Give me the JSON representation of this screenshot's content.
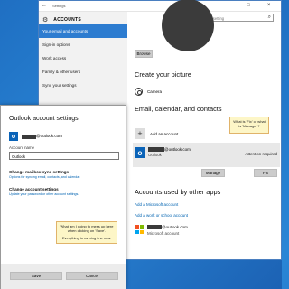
{
  "settings_window": {
    "title": "Settings",
    "header_label": "ACCOUNTS",
    "search_placeholder": "Find a setting",
    "nav": [
      {
        "label": "Your email and accounts",
        "active": true
      },
      {
        "label": "Sign-in options",
        "active": false
      },
      {
        "label": "Work access",
        "active": false
      },
      {
        "label": "Family & other users",
        "active": false
      },
      {
        "label": "Sync your settings",
        "active": false
      }
    ],
    "browse_label": "Browse",
    "create_picture_heading": "Create your picture",
    "camera_label": "Camera",
    "email_heading": "Email, calendar, and contacts",
    "add_account_label": "Add an account",
    "account": {
      "email_suffix": "@outlook.com",
      "type": "Outlook",
      "status": "Attention required",
      "manage_label": "Manage",
      "fix_label": "Fix"
    },
    "other_apps_heading": "Accounts used by other apps",
    "add_ms_account_link": "Add a Microsoft account",
    "add_work_account_link": "Add a work or school account",
    "ms_account": {
      "email_suffix": "@outlook.com",
      "type": "Microsoft account"
    },
    "note_fix": "What is 'Fix' or what is 'Manage' ?"
  },
  "dialog": {
    "title": "Outlook account settings",
    "account_email_suffix": "@outlook.com",
    "account_name_label": "Account name",
    "account_name_value": "Outlook",
    "sync_heading": "Change mailbox sync settings",
    "sync_sub": "Options for syncing email, contacts, and calendar.",
    "change_heading": "Change account settings",
    "change_sub": "Update your password or other account settings.",
    "note_line1": "What am I going to mess up here when clicking on 'Save'.",
    "note_line2": "Everything is running fine now.",
    "save_label": "Save",
    "cancel_label": "Cancel"
  },
  "colors": {
    "accent": "#2d7cd0",
    "desktop": "#2a86d6",
    "outlook_blue": "#0a63b8",
    "link": "#0063b1",
    "note_bg": "#fdf6c7",
    "ms_red": "#f25022",
    "ms_green": "#7fba00",
    "ms_blue": "#00a4ef",
    "ms_yellow": "#ffb900"
  }
}
